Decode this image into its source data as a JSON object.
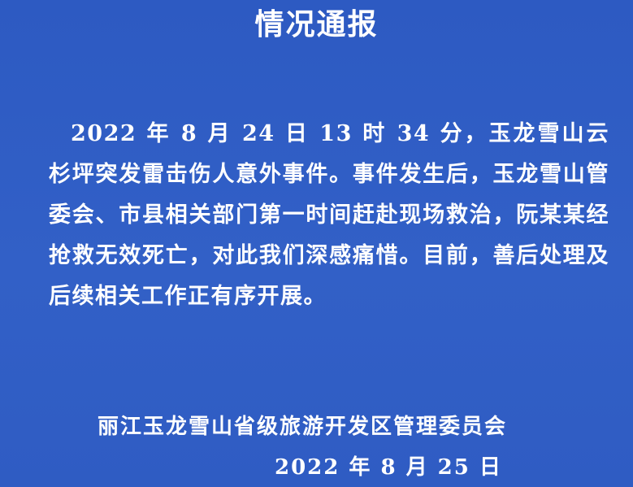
{
  "notice": {
    "title": "情况通报",
    "body": "2022 年 8 月 24 日 13 时 34 分，玉龙雪山云杉坪突发雷击伤人意外事件。事件发生后，玉龙雪山管委会、市县相关部门第一时间赶赴现场救治，阮某某经抢救无效死亡，对此我们深感痛惜。目前，善后处理及后续相关工作正有序开展。",
    "signature_org": "丽江玉龙雪山省级旅游开发区管理委员会",
    "signature_date": "2022 年 8 月 25 日"
  },
  "colors": {
    "background": "#2f5cc4",
    "text": "#ffffff"
  }
}
